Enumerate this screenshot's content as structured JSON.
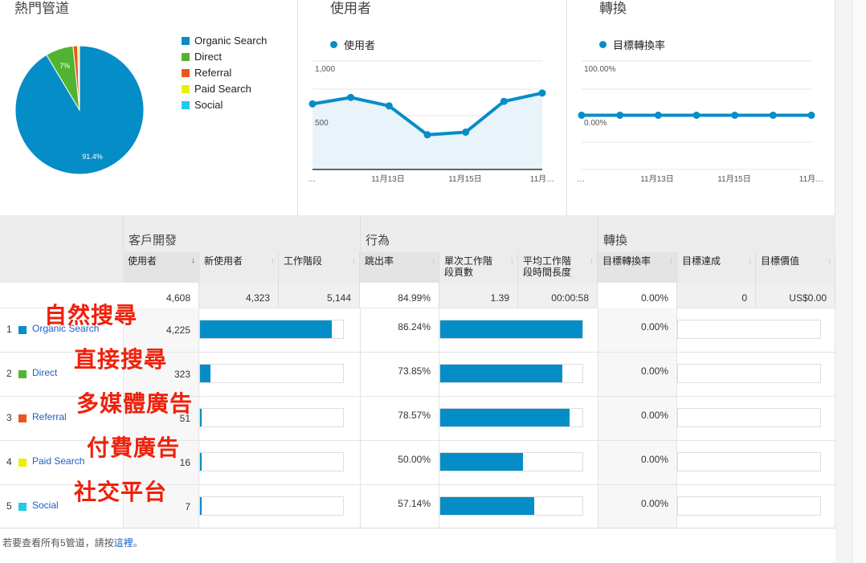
{
  "panels": {
    "channels": {
      "title": "熱門管道"
    },
    "users": {
      "title": "使用者",
      "legend": "使用者"
    },
    "conversion": {
      "title": "轉換",
      "legend": "目標轉換率"
    }
  },
  "chart_data": [
    {
      "type": "pie",
      "title": "熱門管道",
      "categories": [
        "Organic Search",
        "Direct",
        "Referral",
        "Paid Search",
        "Social"
      ],
      "values": [
        4225,
        323,
        51,
        16,
        7
      ],
      "colors": [
        "#058dc7",
        "#50b432",
        "#ed561b",
        "#edef00",
        "#24cbe5"
      ],
      "labels": [
        "91.4%",
        "7%",
        "",
        "",
        ""
      ],
      "legend": "right"
    },
    {
      "type": "area",
      "series": [
        {
          "name": "使用者",
          "values": [
            756,
            830,
            733,
            400,
            430,
            785,
            881
          ]
        }
      ],
      "x_ticks": [
        "…",
        "11月13日",
        "11月15日",
        "11月…"
      ],
      "y_ticks": [
        "1,000",
        "500"
      ],
      "ylim": [
        0,
        1250
      ],
      "color": "#058dc7"
    },
    {
      "type": "line",
      "series": [
        {
          "name": "目標轉換率",
          "values": [
            0,
            0,
            0,
            0,
            0,
            0,
            0
          ]
        }
      ],
      "x_ticks": [
        "…",
        "11月13日",
        "11月15日",
        "11月…"
      ],
      "y_ticks": [
        "100.00%",
        "0.00%"
      ],
      "ylim": [
        -100,
        100
      ],
      "color": "#058dc7"
    }
  ],
  "table": {
    "groups": [
      "客戶開發",
      "行為",
      "轉換"
    ],
    "columns": [
      "使用者",
      "新使用者",
      "工作階段",
      "跳出率",
      "單次工作階段頁數",
      "平均工作階段時間長度",
      "目標轉換率",
      "目標達成",
      "目標價值"
    ],
    "col_lines": [
      [
        "使用者"
      ],
      [
        "新使用者"
      ],
      [
        "工作階段"
      ],
      [
        "跳出率"
      ],
      [
        "單次工作階",
        "段頁數"
      ],
      [
        "平均工作階",
        "段時間長度"
      ],
      [
        "目標轉換率"
      ],
      [
        "目標達成"
      ],
      [
        "目標價值"
      ]
    ],
    "sort_arrow": "↓",
    "totals": [
      "4,608",
      "4,323",
      "5,144",
      "84.99%",
      "1.39",
      "00:00:58",
      "0.00%",
      "0",
      "US$0.00"
    ],
    "rows": [
      {
        "rank": "1",
        "channel": "Organic Search",
        "color": "#058dc7",
        "users": "4,225",
        "users_share": 0.917,
        "bounce": "86.24%",
        "bounce_val": 86.24,
        "conv": "0.00%",
        "annotation": "自然搜尋"
      },
      {
        "rank": "2",
        "channel": "Direct",
        "color": "#50b432",
        "users": "323",
        "users_share": 0.07,
        "bounce": "73.85%",
        "bounce_val": 73.85,
        "conv": "0.00%",
        "annotation": "直接搜尋"
      },
      {
        "rank": "3",
        "channel": "Referral",
        "color": "#ed561b",
        "users": "51",
        "users_share": 0.011,
        "bounce": "78.57%",
        "bounce_val": 78.57,
        "conv": "0.00%",
        "annotation": "多媒體廣告"
      },
      {
        "rank": "4",
        "channel": "Paid Search",
        "color": "#edef00",
        "users": "16",
        "users_share": 0.0035,
        "bounce": "50.00%",
        "bounce_val": 50.0,
        "conv": "0.00%",
        "annotation": "付費廣告"
      },
      {
        "rank": "5",
        "channel": "Social",
        "color": "#24cbe5",
        "users": "7",
        "users_share": 0.0015,
        "bounce": "57.14%",
        "bounce_val": 57.14,
        "conv": "0.00%",
        "annotation": "社交平台"
      }
    ]
  },
  "footer": {
    "text": "若要查看所有5管道，請按",
    "link": "這裡",
    "end": "。"
  }
}
